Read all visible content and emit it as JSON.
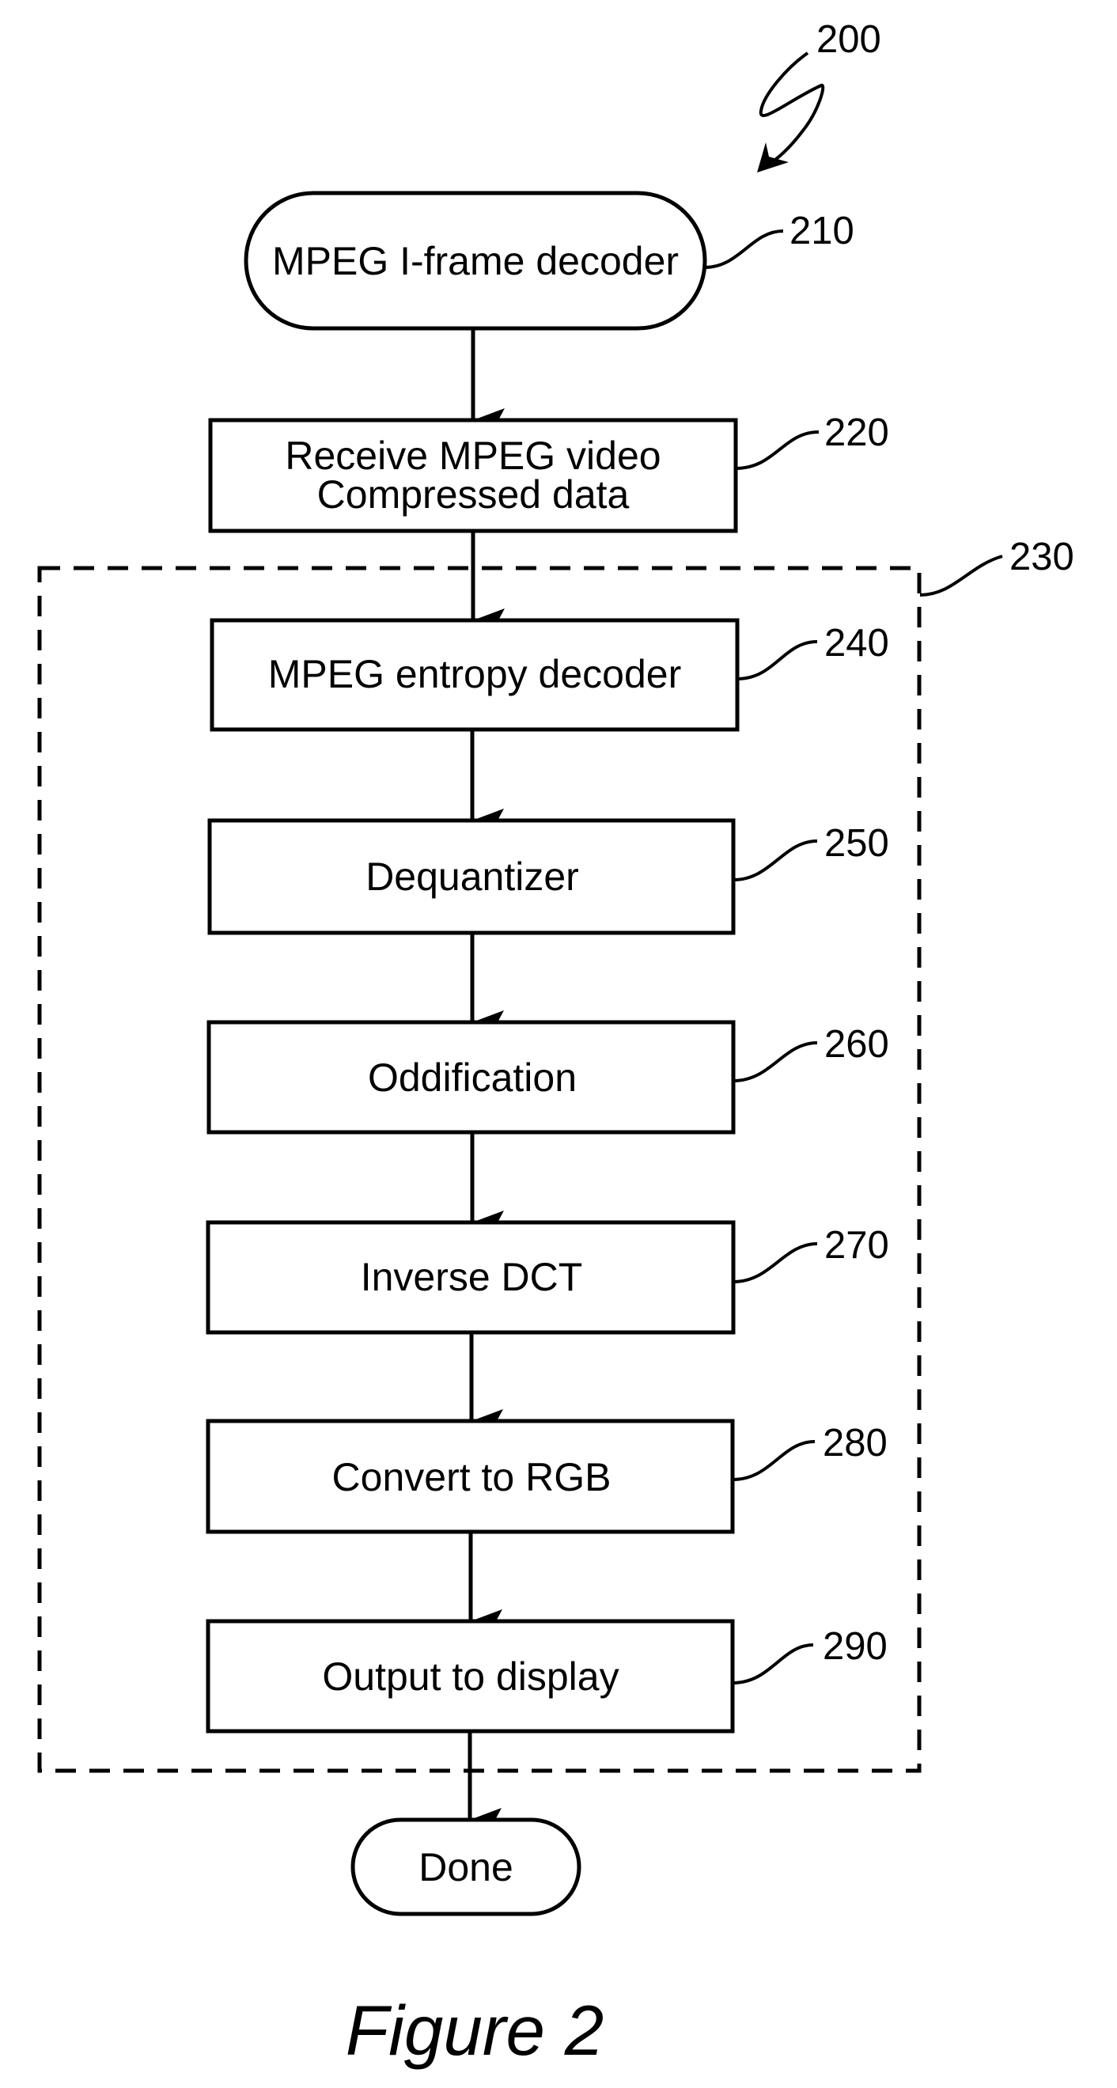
{
  "figure": {
    "caption": "Figure 2",
    "reference": "200",
    "dashed_group_reference": "230",
    "colors": {
      "ink": "#000000",
      "paper": "#ffffff"
    }
  },
  "nodes": [
    {
      "id": "210",
      "shape": "terminal",
      "lines": [
        "MPEG I-frame decoder"
      ]
    },
    {
      "id": "220",
      "shape": "process",
      "lines": [
        "Receive MPEG video",
        "Compressed data"
      ]
    },
    {
      "id": "240",
      "shape": "process",
      "lines": [
        "MPEG entropy decoder"
      ]
    },
    {
      "id": "250",
      "shape": "process",
      "lines": [
        "Dequantizer"
      ]
    },
    {
      "id": "260",
      "shape": "process",
      "lines": [
        "Oddification"
      ]
    },
    {
      "id": "270",
      "shape": "process",
      "lines": [
        "Inverse DCT"
      ]
    },
    {
      "id": "280",
      "shape": "process",
      "lines": [
        "Convert to RGB"
      ]
    },
    {
      "id": "290",
      "shape": "process",
      "lines": [
        "Output to display"
      ]
    },
    {
      "id": "done",
      "shape": "terminal",
      "lines": [
        "Done"
      ]
    }
  ],
  "edges": [
    [
      "210",
      "220"
    ],
    [
      "220",
      "240"
    ],
    [
      "240",
      "250"
    ],
    [
      "250",
      "260"
    ],
    [
      "260",
      "270"
    ],
    [
      "270",
      "280"
    ],
    [
      "280",
      "290"
    ],
    [
      "290",
      "done"
    ]
  ],
  "dashed_group": {
    "label": "230",
    "contains": [
      "240",
      "250",
      "260",
      "270",
      "280",
      "290"
    ]
  }
}
